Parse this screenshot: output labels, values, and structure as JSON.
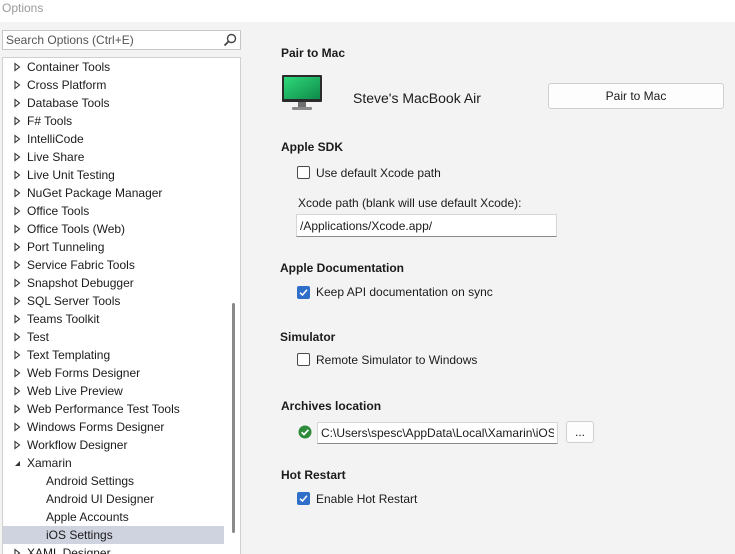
{
  "window": {
    "title": "Options"
  },
  "search": {
    "placeholder": "Search Options (Ctrl+E)"
  },
  "tree": {
    "items": [
      {
        "label": "Container Tools",
        "expanded": false
      },
      {
        "label": "Cross Platform",
        "expanded": false
      },
      {
        "label": "Database Tools",
        "expanded": false
      },
      {
        "label": "F# Tools",
        "expanded": false
      },
      {
        "label": "IntelliCode",
        "expanded": false
      },
      {
        "label": "Live Share",
        "expanded": false
      },
      {
        "label": "Live Unit Testing",
        "expanded": false
      },
      {
        "label": "NuGet Package Manager",
        "expanded": false
      },
      {
        "label": "Office Tools",
        "expanded": false
      },
      {
        "label": "Office Tools (Web)",
        "expanded": false
      },
      {
        "label": "Port Tunneling",
        "expanded": false
      },
      {
        "label": "Service Fabric Tools",
        "expanded": false
      },
      {
        "label": "Snapshot Debugger",
        "expanded": false
      },
      {
        "label": "SQL Server Tools",
        "expanded": false
      },
      {
        "label": "Teams Toolkit",
        "expanded": false
      },
      {
        "label": "Test",
        "expanded": false
      },
      {
        "label": "Text Templating",
        "expanded": false
      },
      {
        "label": "Web Forms Designer",
        "expanded": false
      },
      {
        "label": "Web Live Preview",
        "expanded": false
      },
      {
        "label": "Web Performance Test Tools",
        "expanded": false
      },
      {
        "label": "Windows Forms Designer",
        "expanded": false
      },
      {
        "label": "Workflow Designer",
        "expanded": false
      },
      {
        "label": "Xamarin",
        "expanded": true
      },
      {
        "label": "Android Settings",
        "child": true
      },
      {
        "label": "Android UI Designer",
        "child": true
      },
      {
        "label": "Apple Accounts",
        "child": true
      },
      {
        "label": "iOS Settings",
        "child": true,
        "selected": true
      },
      {
        "label": "XAML Designer",
        "expanded": false
      }
    ]
  },
  "pair": {
    "title": "Pair to Mac",
    "device_name": "Steve's MacBook Air",
    "button_label": "Pair to Mac"
  },
  "sdk": {
    "title": "Apple SDK",
    "use_default_label": "Use default Xcode path",
    "use_default_checked": false,
    "xcode_path_label": "Xcode path (blank will use default Xcode):",
    "xcode_path_value": "/Applications/Xcode.app/"
  },
  "docs": {
    "title": "Apple Documentation",
    "keep_label": "Keep API documentation on sync",
    "keep_checked": true
  },
  "simulator": {
    "title": "Simulator",
    "remote_label": "Remote Simulator to Windows",
    "remote_checked": false
  },
  "archives": {
    "title": "Archives location",
    "path_value": "C:\\Users\\spesc\\AppData\\Local\\Xamarin\\iOS",
    "browse_label": "...",
    "status_icon": "check-circle-icon",
    "status_color": "#2e8b3a"
  },
  "hot_restart": {
    "title": "Hot Restart",
    "enable_label": "Enable Hot Restart",
    "enable_checked": true
  }
}
